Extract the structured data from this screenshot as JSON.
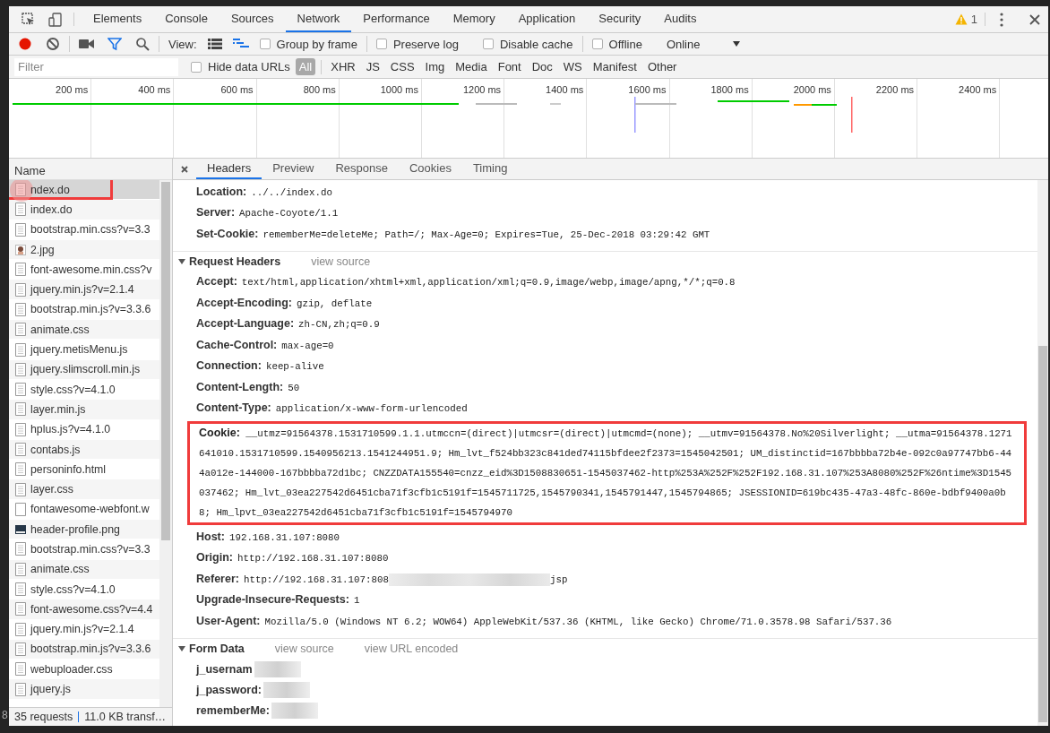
{
  "tabbar": {
    "tabs": [
      {
        "label": "Elements",
        "selected": false
      },
      {
        "label": "Console",
        "selected": false
      },
      {
        "label": "Sources",
        "selected": false
      },
      {
        "label": "Network",
        "selected": true
      },
      {
        "label": "Performance",
        "selected": false
      },
      {
        "label": "Memory",
        "selected": false
      },
      {
        "label": "Application",
        "selected": false
      },
      {
        "label": "Security",
        "selected": false
      },
      {
        "label": "Audits",
        "selected": false
      }
    ],
    "warnings": "1"
  },
  "toolbar": {
    "view_label": "View:",
    "checkboxes": [
      {
        "label": "Group by frame",
        "checked": false
      },
      {
        "label": "Preserve log",
        "checked": false
      },
      {
        "label": "Disable cache",
        "checked": false
      },
      {
        "label": "Offline",
        "checked": false
      }
    ],
    "throttling": "Online"
  },
  "filter_bar": {
    "placeholder": "Filter",
    "hide_data_urls": {
      "label": "Hide data URLs",
      "checked": false
    },
    "types": [
      {
        "label": "All",
        "selected": true
      },
      {
        "label": "XHR",
        "selected": false
      },
      {
        "label": "JS",
        "selected": false
      },
      {
        "label": "CSS",
        "selected": false
      },
      {
        "label": "Img",
        "selected": false
      },
      {
        "label": "Media",
        "selected": false
      },
      {
        "label": "Font",
        "selected": false
      },
      {
        "label": "Doc",
        "selected": false
      },
      {
        "label": "WS",
        "selected": false
      },
      {
        "label": "Manifest",
        "selected": false
      },
      {
        "label": "Other",
        "selected": false
      }
    ]
  },
  "overview": {
    "ticks": [
      "200 ms",
      "400 ms",
      "600 ms",
      "800 ms",
      "1000 ms",
      "1200 ms",
      "1400 ms",
      "1600 ms",
      "1800 ms",
      "2000 ms",
      "2200 ms",
      "2400 ms"
    ]
  },
  "requests": {
    "header": "Name",
    "items": [
      {
        "name": "ndex.do",
        "kind": "doc",
        "selected": true,
        "redacted": true,
        "annotated": true
      },
      {
        "name": "index.do",
        "kind": "doc",
        "selected": false
      },
      {
        "name": "bootstrap.min.css?v=3.3",
        "kind": "doc",
        "selected": false
      },
      {
        "name": "2.jpg",
        "kind": "photo",
        "selected": false
      },
      {
        "name": "font-awesome.min.css?v",
        "kind": "doc",
        "selected": false
      },
      {
        "name": "jquery.min.js?v=2.1.4",
        "kind": "doc",
        "selected": false
      },
      {
        "name": "bootstrap.min.js?v=3.3.6",
        "kind": "doc",
        "selected": false
      },
      {
        "name": "animate.css",
        "kind": "doc",
        "selected": false
      },
      {
        "name": "jquery.metisMenu.js",
        "kind": "doc",
        "selected": false
      },
      {
        "name": "jquery.slimscroll.min.js",
        "kind": "doc",
        "selected": false
      },
      {
        "name": "style.css?v=4.1.0",
        "kind": "doc",
        "selected": false
      },
      {
        "name": "layer.min.js",
        "kind": "doc",
        "selected": false
      },
      {
        "name": "hplus.js?v=4.1.0",
        "kind": "doc",
        "selected": false
      },
      {
        "name": "contabs.js",
        "kind": "doc",
        "selected": false
      },
      {
        "name": "personinfo.html",
        "kind": "doc",
        "selected": false
      },
      {
        "name": "layer.css",
        "kind": "doc",
        "selected": false
      },
      {
        "name": "fontawesome-webfont.w",
        "kind": "blank",
        "selected": false
      },
      {
        "name": "header-profile.png",
        "kind": "dark",
        "selected": false
      },
      {
        "name": "bootstrap.min.css?v=3.3",
        "kind": "doc",
        "selected": false
      },
      {
        "name": "animate.css",
        "kind": "doc",
        "selected": false
      },
      {
        "name": "style.css?v=4.1.0",
        "kind": "doc",
        "selected": false
      },
      {
        "name": "font-awesome.css?v=4.4",
        "kind": "doc",
        "selected": false
      },
      {
        "name": "jquery.min.js?v=2.1.4",
        "kind": "doc",
        "selected": false
      },
      {
        "name": "bootstrap.min.js?v=3.3.6",
        "kind": "doc",
        "selected": false
      },
      {
        "name": "webuploader.css",
        "kind": "doc",
        "selected": false
      },
      {
        "name": "jquery.js",
        "kind": "doc",
        "selected": false
      }
    ],
    "status": [
      "35 requests",
      "11.0 KB transf…"
    ]
  },
  "edge_text": "8",
  "details": {
    "tabs": [
      {
        "label": "Headers",
        "selected": true
      },
      {
        "label": "Preview",
        "selected": false
      },
      {
        "label": "Response",
        "selected": false
      },
      {
        "label": "Cookies",
        "selected": false
      },
      {
        "label": "Timing",
        "selected": false
      }
    ],
    "response_headers_tail": [
      {
        "name": "Location:",
        "value": "../../index.do"
      },
      {
        "name": "Server:",
        "value": "Apache-Coyote/1.1"
      },
      {
        "name": "Set-Cookie:",
        "value": "rememberMe=deleteMe; Path=/; Max-Age=0; Expires=Tue, 25-Dec-2018 03:29:42 GMT"
      }
    ],
    "request_headers": {
      "title": "Request Headers",
      "expanded": true,
      "links": [
        "view source"
      ],
      "headers": [
        {
          "name": "Accept:",
          "value": "text/html,application/xhtml+xml,application/xml;q=0.9,image/webp,image/apng,*/*;q=0.8"
        },
        {
          "name": "Accept-Encoding:",
          "value": "gzip, deflate"
        },
        {
          "name": "Accept-Language:",
          "value": "zh-CN,zh;q=0.9"
        },
        {
          "name": "Cache-Control:",
          "value": "max-age=0"
        },
        {
          "name": "Connection:",
          "value": "keep-alive"
        },
        {
          "name": "Content-Length:",
          "value": "50"
        },
        {
          "name": "Content-Type:",
          "value": "application/x-www-form-urlencoded"
        },
        {
          "name": "Cookie:",
          "value": "__utmz=91564378.1531710599.1.1.utmccn=(direct)|utmcsr=(direct)|utmcmd=(none); __utmv=91564378.No%20Silverlight; __utma=91564378.1271641010.1531710599.1540956213.1541244951.9; Hm_lvt_f524bb323c841ded74115bfdee2f2373=1545042501; UM_distinctid=167bbbba72b4e-092c0a97747bb6-444a012e-144000-167bbbba72d1bc; CNZZDATA155540=cnzz_eid%3D1508830651-1545037462-http%253A%252F%252F192.168.31.107%253A8080%252F%26ntime%3D1545037462; Hm_lvt_03ea227542d6451cba71f3cfb1c5191f=1545711725,1545790341,1545791447,1545794865; JSESSIONID=619bc435-47a3-48fc-860e-bdbf9400a0b8; Hm_lpvt_03ea227542d6451cba71f3cfb1c5191f=1545794970",
          "annotated": true
        },
        {
          "name": "Host:",
          "value": "192.168.31.107:8080"
        },
        {
          "name": "Origin:",
          "value": "http://192.168.31.107:8080"
        },
        {
          "name": "Referer:",
          "value": "http://192.168.31.107:808",
          "redacted": true,
          "value_end": "jsp"
        },
        {
          "name": "Upgrade-Insecure-Requests:",
          "value": "1"
        },
        {
          "name": "User-Agent:",
          "value": "Mozilla/5.0 (Windows NT 6.2; WOW64) AppleWebKit/537.36 (KHTML, like Gecko) Chrome/71.0.3578.98 Safari/537.36"
        }
      ]
    },
    "form_data": {
      "title": "Form Data",
      "expanded": true,
      "links": [
        "view source",
        "view URL encoded"
      ],
      "fields": [
        {
          "name": "j_usernam",
          "redacted": true
        },
        {
          "name": "j_password:",
          "redacted": true
        },
        {
          "name": "rememberMe:",
          "redacted": true
        }
      ]
    }
  }
}
